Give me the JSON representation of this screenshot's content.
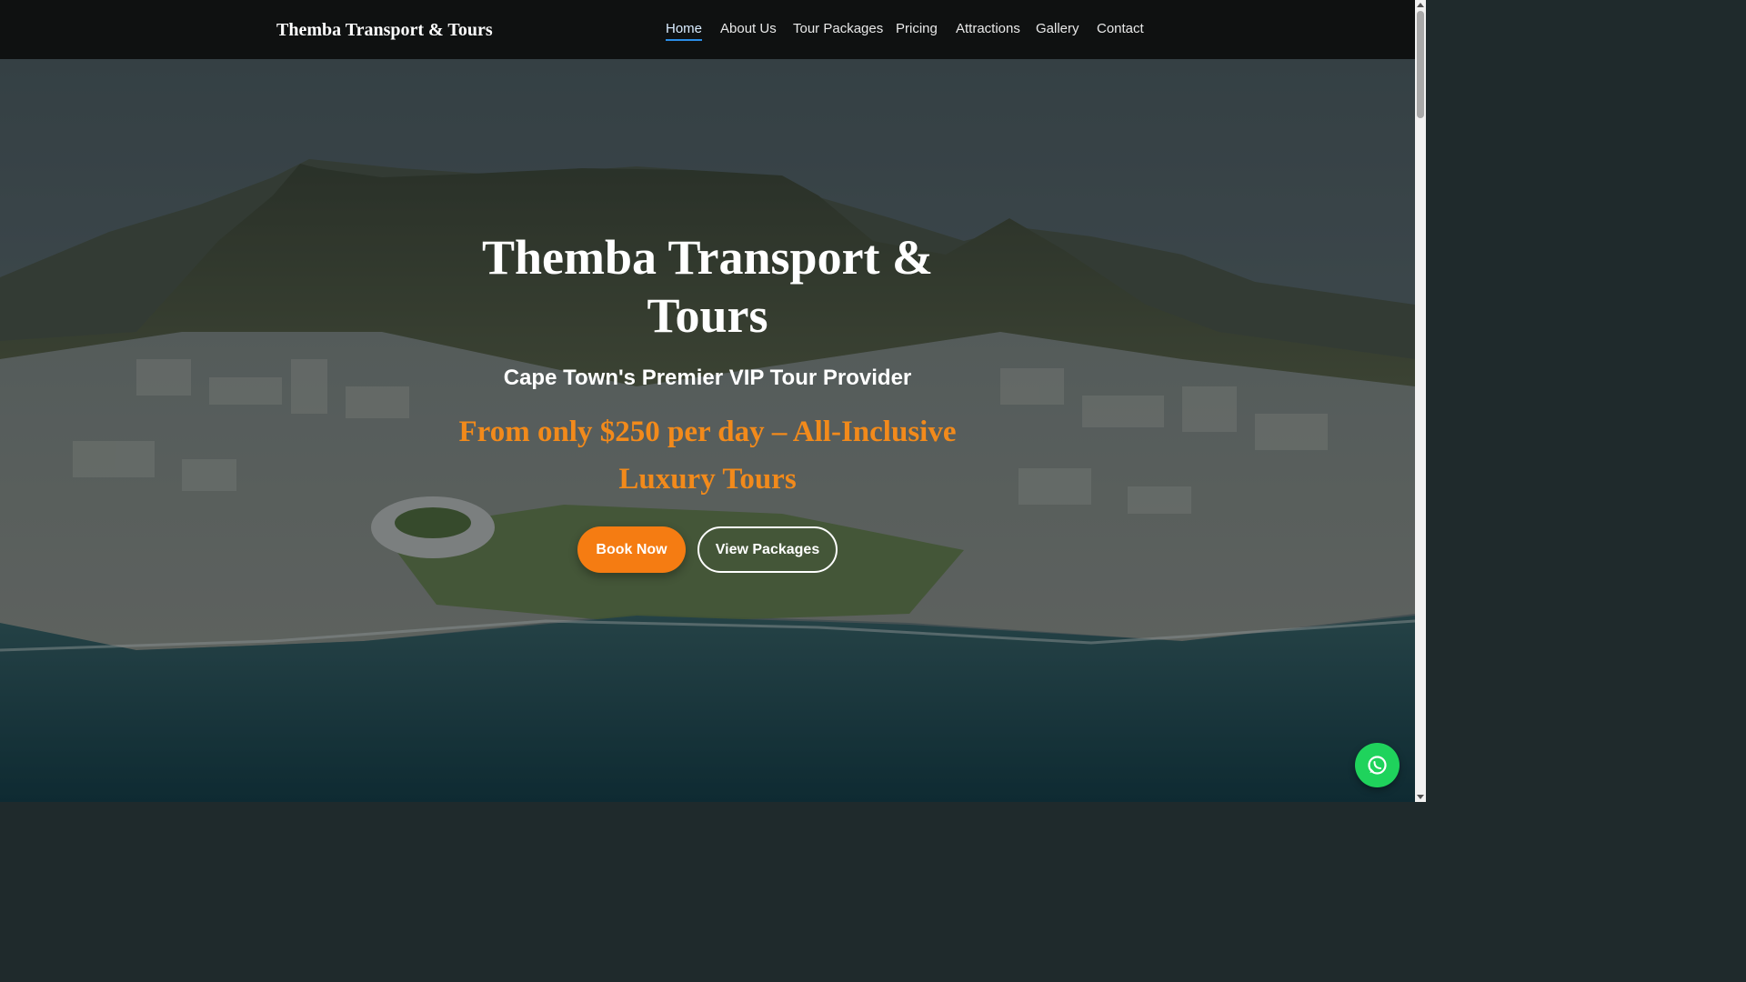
{
  "header": {
    "brand": "Themba Transport & Tours",
    "nav": [
      {
        "label": "Home",
        "active": true
      },
      {
        "label": "About Us"
      },
      {
        "label": "Tour Packages"
      },
      {
        "label": "Pricing"
      },
      {
        "label": "Attractions"
      },
      {
        "label": "Gallery"
      },
      {
        "label": "Contact"
      }
    ]
  },
  "hero": {
    "title_line1": "Themba Transport &",
    "title_line2": "Tours",
    "subtitle": "Cape Town's Premier VIP Tour Provider",
    "price_line1": "From only $250 per day – All-Inclusive",
    "price_line2": "Luxury Tours",
    "book_label": "Book Now",
    "packages_label": "View Packages",
    "background_image": "aerial view of Cape Town with Table Mountain, stadium and coastline"
  },
  "floating": {
    "icon": "whatsapp-icon"
  },
  "colors": {
    "accent_orange": "#f57c12",
    "price_orange": "#f28a1b",
    "whatsapp_green": "#1fd35c",
    "header_bg": "#0f1111",
    "nav_active_underline": "#2b8de6"
  }
}
